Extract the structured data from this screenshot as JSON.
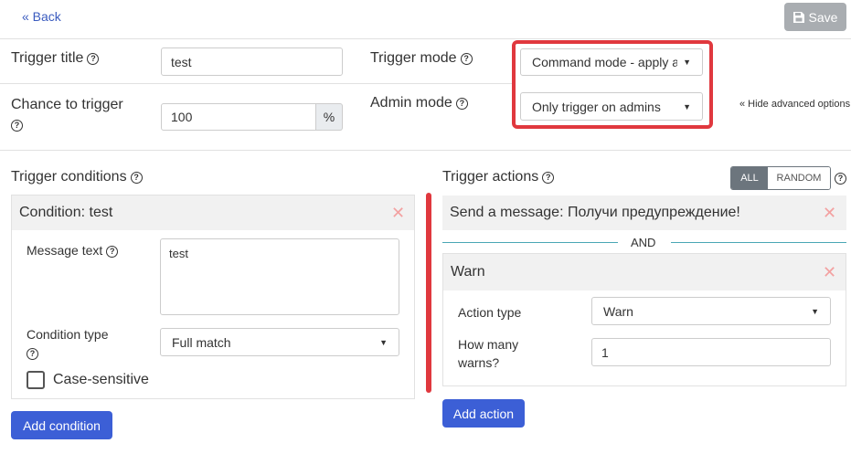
{
  "header": {
    "back_label": "« Back",
    "save_label": "Save"
  },
  "settings": {
    "trigger_title_label": "Trigger title",
    "trigger_title_value": "test",
    "trigger_mode_label": "Trigger mode",
    "trigger_mode_value": "Command mode - apply a",
    "chance_label": "Chance to trigger",
    "chance_value": "100",
    "chance_unit": "%",
    "admin_mode_label": "Admin mode",
    "admin_mode_value": "Only trigger on admins",
    "hide_advanced": "« Hide advanced options"
  },
  "conditions": {
    "title": "Trigger conditions",
    "items": [
      {
        "header": "Condition: test",
        "message_text_label": "Message text",
        "message_text_value": "test",
        "condition_type_label": "Condition type",
        "condition_type_value": "Full match",
        "case_sensitive_label": "Case-sensitive",
        "case_sensitive_checked": false
      }
    ],
    "add_button": "Add condition"
  },
  "actions": {
    "title": "Trigger actions",
    "toggle": {
      "all": "ALL",
      "random": "RANDOM",
      "active": "ALL"
    },
    "items": [
      {
        "header": "Send a message: Получи предупреждение!"
      },
      {
        "header": "Warn",
        "action_type_label": "Action type",
        "action_type_value": "Warn",
        "how_many_label": "How many warns?",
        "how_many_value": "1"
      }
    ],
    "separator": "AND",
    "add_button": "Add action"
  },
  "colors": {
    "accent_blue": "#3c5fd6",
    "highlight_red": "#e0383e",
    "remove_icon": "#f3a1a1",
    "divider_teal": "#4aa6b5"
  }
}
